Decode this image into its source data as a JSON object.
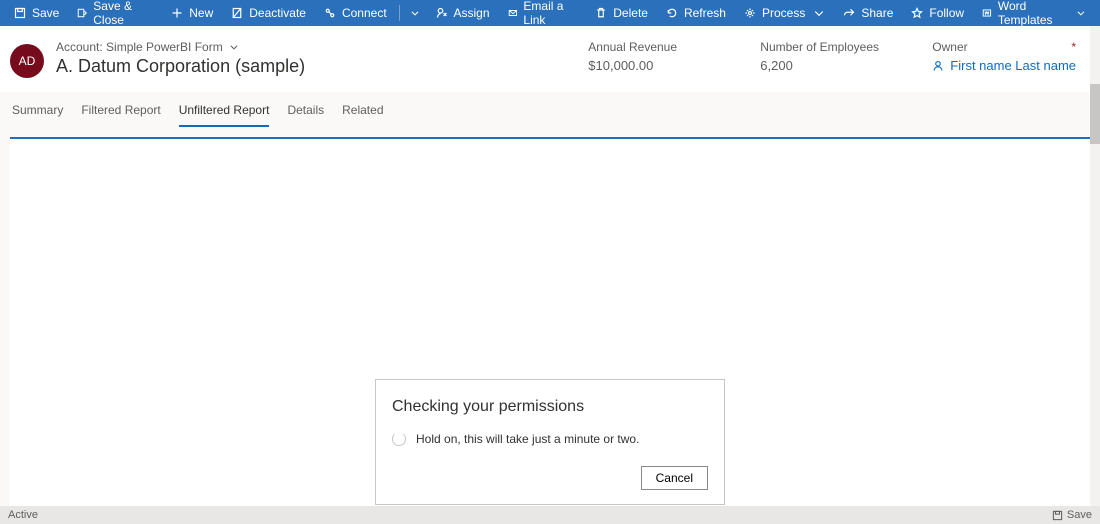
{
  "commands": {
    "save": "Save",
    "save_close": "Save & Close",
    "new": "New",
    "deactivate": "Deactivate",
    "connect": "Connect",
    "assign": "Assign",
    "email_link": "Email a Link",
    "delete": "Delete",
    "refresh": "Refresh",
    "process": "Process",
    "share": "Share",
    "follow": "Follow",
    "word_templates": "Word Templates"
  },
  "header": {
    "avatar_initials": "AD",
    "breadcrumb": "Account: Simple PowerBI Form",
    "title": "A. Datum Corporation (sample)",
    "fields": {
      "annual_revenue": {
        "label": "Annual Revenue",
        "value": "$10,000.00"
      },
      "num_employees": {
        "label": "Number of Employees",
        "value": "6,200"
      },
      "owner": {
        "label": "Owner",
        "value": "First name Last name"
      }
    }
  },
  "tabs": {
    "summary": "Summary",
    "filtered": "Filtered Report",
    "unfiltered": "Unfiltered Report",
    "details": "Details",
    "related": "Related"
  },
  "dialog": {
    "title": "Checking your permissions",
    "body": "Hold on, this will take just a minute or two.",
    "cancel": "Cancel"
  },
  "status": {
    "state": "Active",
    "save": "Save"
  }
}
